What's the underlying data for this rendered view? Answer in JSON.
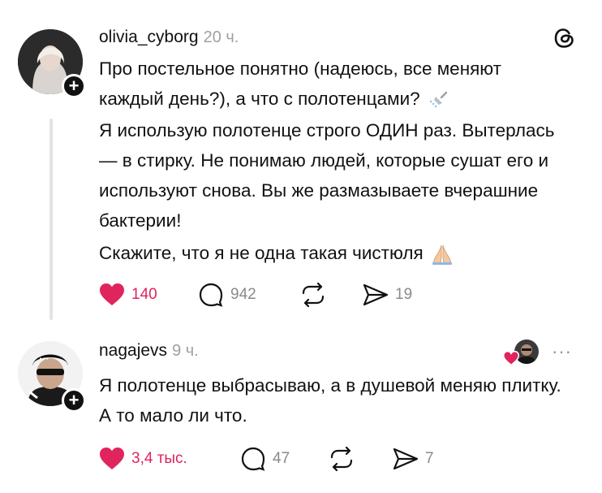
{
  "posts": [
    {
      "username": "olivia_cyborg",
      "time": "20 ч.",
      "paragraphs": [
        "Про постельное понятно (надеюсь, все меняют каждый день?), а что с полотенцами?",
        "Я использую полотенце строго ОДИН раз. Вытерлась — в стирку. Не понимаю людей, которые сушат его и используют снова. Вы же размазываете вчерашние бактерии!",
        "Скажите, что я не одна такая чистюля"
      ],
      "likes": "140",
      "replies": "942",
      "shares": "19"
    },
    {
      "username": "nagajevs",
      "time": "9 ч.",
      "text": "Я полотенце выбрасываю, а в душевой меняю плитку. А то мало ли что.",
      "likes": "3,4 тыс.",
      "replies": "47",
      "shares": "7",
      "more": "···"
    }
  ],
  "avatar_badge": "+",
  "colors": {
    "like_red": "#e0245e",
    "muted": "#8a8a8a",
    "text": "#111111"
  },
  "icons": [
    "threads-logo-icon",
    "shower-icon",
    "praying-hands-icon",
    "heart-icon",
    "comment-icon",
    "repost-icon",
    "share-icon",
    "more-icon"
  ]
}
